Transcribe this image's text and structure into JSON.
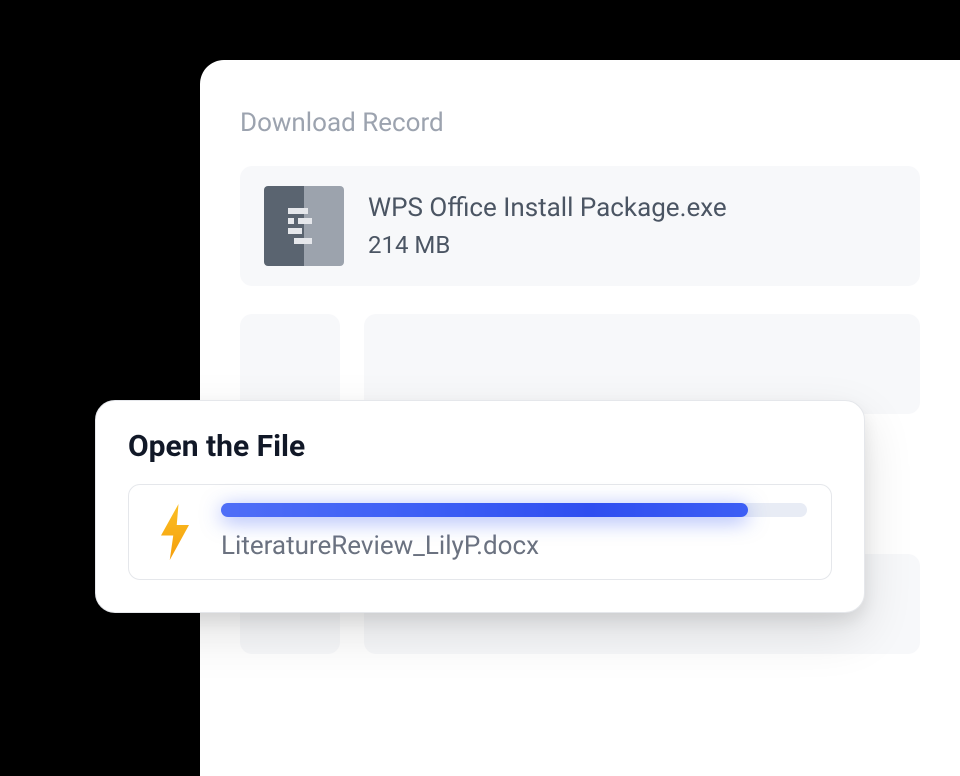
{
  "download_panel": {
    "title": "Download Record",
    "items": [
      {
        "name": "WPS Office Install Package.exe",
        "size": "214 MB",
        "icon": "exe-file-icon"
      }
    ]
  },
  "open_file_card": {
    "title": "Open the File",
    "filename": "LiteratureReview_LilyP.docx",
    "progress_percent": 90,
    "icon": "lightning-bolt-icon"
  }
}
